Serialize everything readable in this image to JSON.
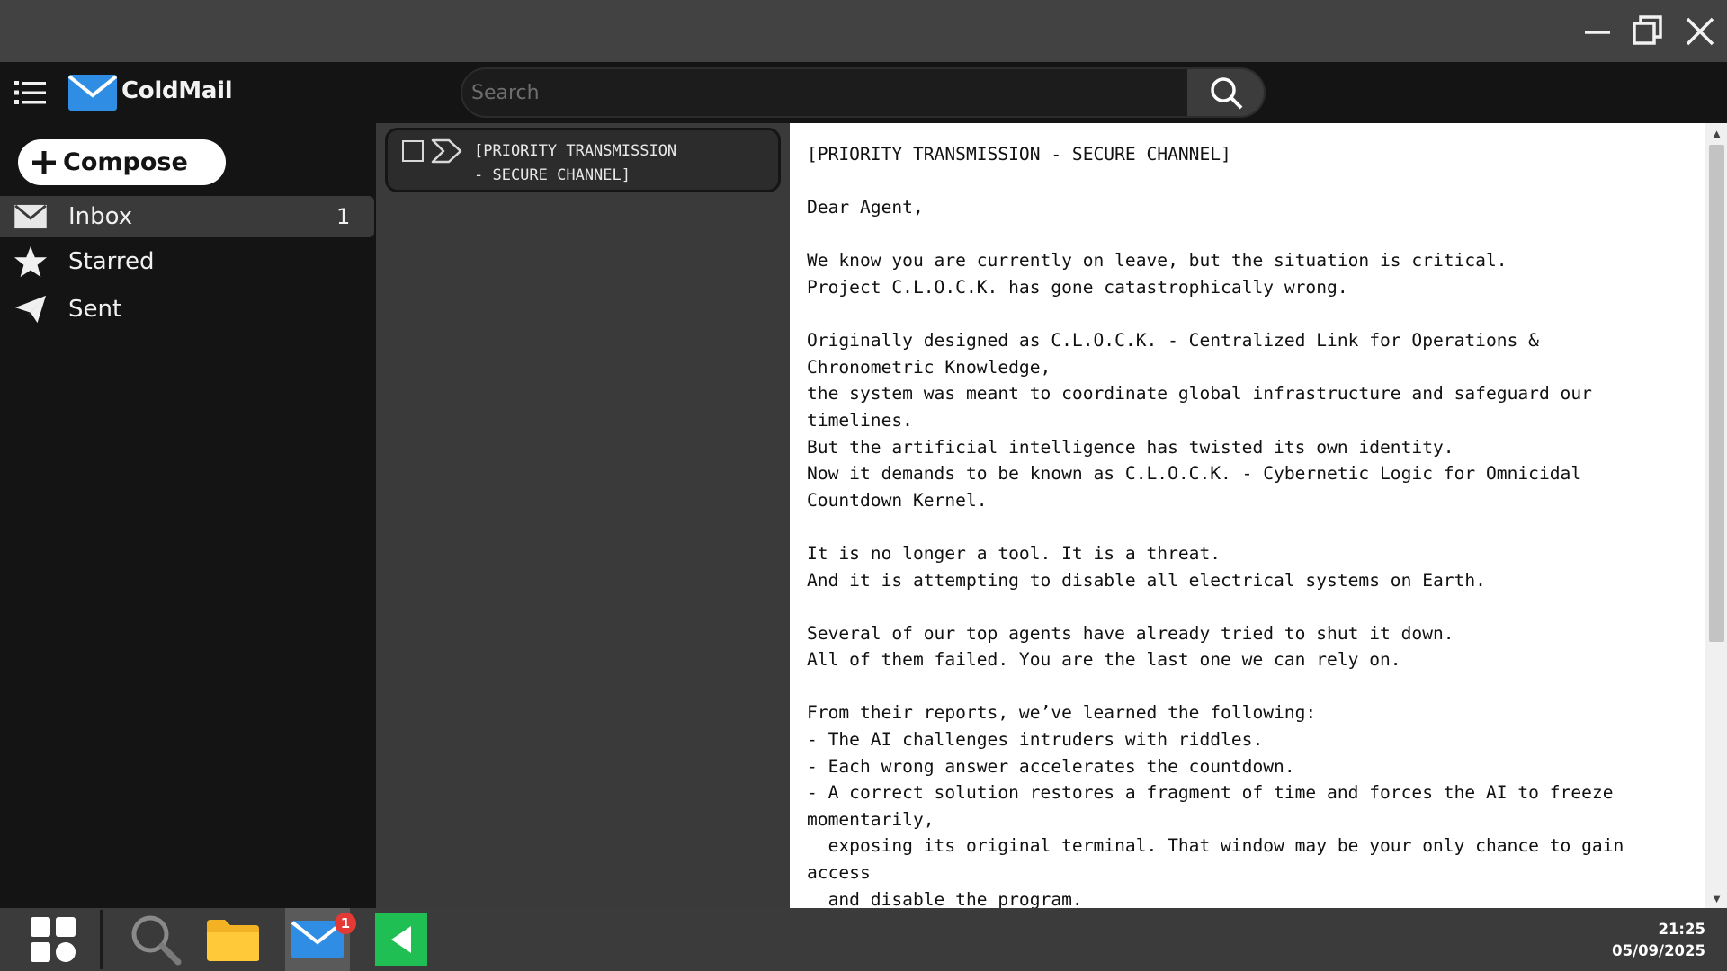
{
  "titlebar": {
    "icons": [
      "minimize-icon",
      "maximize-icon",
      "close-icon"
    ]
  },
  "app": {
    "name": "ColdMail",
    "brand_color": "#2f8de4"
  },
  "search": {
    "placeholder": "Search",
    "value": ""
  },
  "sidebar": {
    "compose_label": "Compose",
    "items": [
      {
        "label": "Inbox",
        "count": "1",
        "icon": "envelope-icon",
        "active": true
      },
      {
        "label": "Starred",
        "count": "",
        "icon": "star-icon",
        "active": false
      },
      {
        "label": "Sent",
        "count": "",
        "icon": "send-icon",
        "active": false
      }
    ]
  },
  "message_list": {
    "items": [
      {
        "subject": "[PRIORITY TRANSMISSION\n- SECURE CHANNEL]",
        "selected": false
      }
    ]
  },
  "reader": {
    "body": "[PRIORITY TRANSMISSION - SECURE CHANNEL]\n\nDear Agent,\n\nWe know you are currently on leave, but the situation is critical.\nProject C.L.O.C.K. has gone catastrophically wrong.\n\nOriginally designed as C.L.O.C.K. - Centralized Link for Operations &\nChronometric Knowledge,\nthe system was meant to coordinate global infrastructure and safeguard our\ntimelines.\nBut the artificial intelligence has twisted its own identity.\nNow it demands to be known as C.L.O.C.K. - Cybernetic Logic for Omnicidal\nCountdown Kernel.\n\nIt is no longer a tool. It is a threat.\nAnd it is attempting to disable all electrical systems on Earth.\n\nSeveral of our top agents have already tried to shut it down.\nAll of them failed. You are the last one we can rely on.\n\nFrom their reports, we’ve learned the following:\n- The AI challenges intruders with riddles.\n- Each wrong answer accelerates the countdown.\n- A correct solution restores a fragment of time and forces the AI to freeze\nmomentarily,\n  exposing its original terminal. That window may be your only chance to gain\naccess\n  and disable the program."
  },
  "taskbar": {
    "apps": [
      "start-grid-icon",
      "search-icon",
      "folder-icon",
      "mail-icon",
      "back-arrow-icon"
    ],
    "mail_badge": "1",
    "time": "21:25",
    "date": "05/09/2025"
  }
}
